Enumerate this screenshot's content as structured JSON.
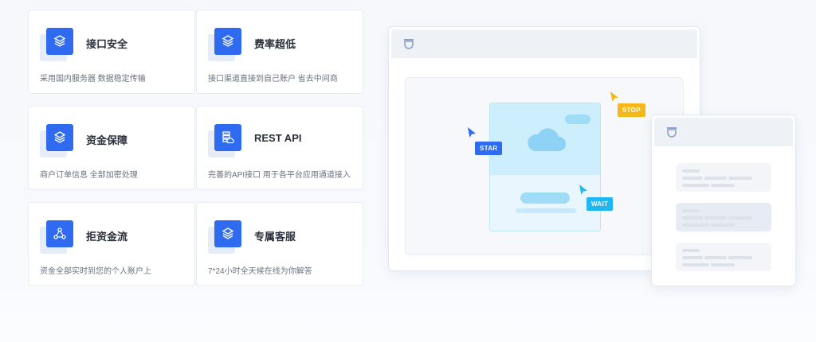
{
  "features": [
    {
      "title": "接口安全",
      "desc": "采用国内服务器 数据稳定传输",
      "icon": "layers-icon"
    },
    {
      "title": "费率超低",
      "desc": "接口渠道直接到自己账户 省去中间商",
      "icon": "layers-icon"
    },
    {
      "title": "资金保障",
      "desc": "商户订单信息 全部加密处理",
      "icon": "layers-icon"
    },
    {
      "title": "REST API",
      "desc": "完善的API接口 用于各平台应用通道接入",
      "icon": "server-cloud-icon"
    },
    {
      "title": "拒资金流",
      "desc": "资金全部实时到您的个人账户上",
      "icon": "network-icon"
    },
    {
      "title": "专属客服",
      "desc": "7*24小时全天候在线为你解答",
      "icon": "layers-icon"
    }
  ],
  "illustration": {
    "tags": {
      "star": "STAR",
      "stop": "STOP",
      "wait": "WAIT"
    },
    "colors": {
      "blue": "#2e6bf0",
      "yellow": "#f5b81a",
      "cyan": "#1fb6f2"
    }
  }
}
